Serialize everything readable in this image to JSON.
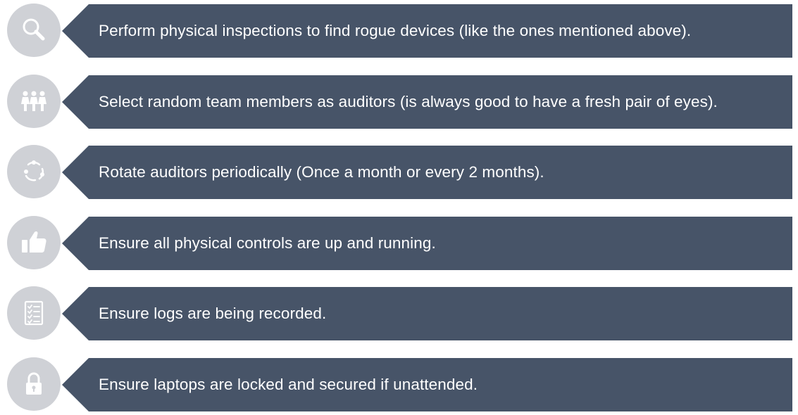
{
  "items": [
    {
      "icon": "magnifier-icon",
      "text": "Perform physical inspections to find rogue devices (like the ones mentioned above)."
    },
    {
      "icon": "team-members-icon",
      "text": "Select random team members as auditors (is always good to have a fresh pair of eyes)."
    },
    {
      "icon": "rotate-cycle-icon",
      "text": "Rotate auditors periodically (Once a month or every 2 months)."
    },
    {
      "icon": "thumbs-up-icon",
      "text": "Ensure all physical controls are up and running."
    },
    {
      "icon": "checklist-icon",
      "text": "Ensure logs are being recorded."
    },
    {
      "icon": "padlock-icon",
      "text": "Ensure laptops are locked and secured if unattended."
    }
  ],
  "colors": {
    "banner": "#475468",
    "circle": "#cfd1d6",
    "icon": "#ffffff",
    "text": "#ffffff"
  }
}
